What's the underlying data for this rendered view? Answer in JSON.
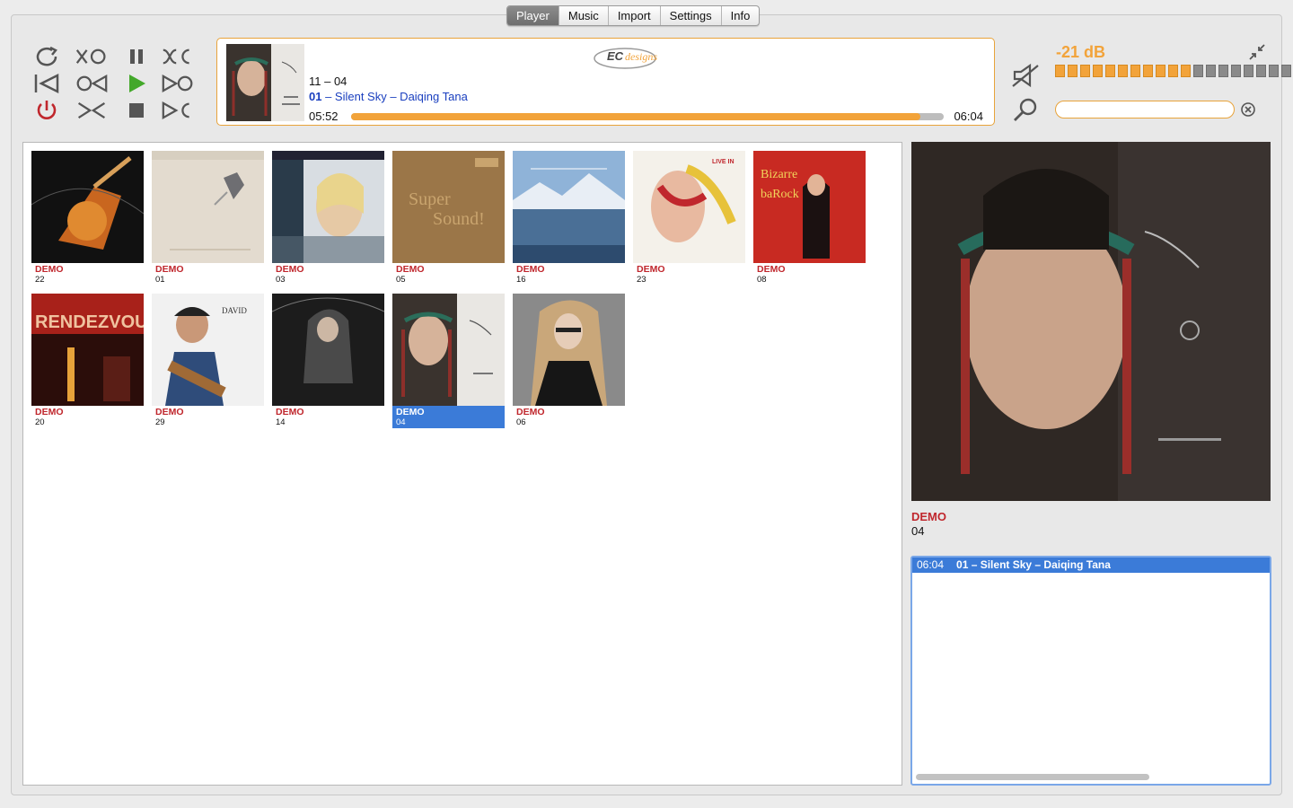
{
  "tabs": [
    {
      "label": "Player",
      "active": true
    },
    {
      "label": "Music",
      "active": false
    },
    {
      "label": "Import",
      "active": false
    },
    {
      "label": "Settings",
      "active": false
    },
    {
      "label": "Info",
      "active": false
    }
  ],
  "controls": {
    "icons": [
      "repeat-icon",
      "shuffle-off-icon",
      "pause-icon",
      "crossfade-icon",
      "previous-icon",
      "rewind-icon",
      "play-icon",
      "forward-icon",
      "power-icon",
      "shrink-icon",
      "stop-icon",
      "next-icon"
    ]
  },
  "nowplaying": {
    "album_track": "11 – 04",
    "track_no": "01",
    "track_rest": " – Silent Sky – Daiqing Tana",
    "elapsed": "05:52",
    "total": "06:04",
    "progress": 0.96,
    "logo_text": "EC designs"
  },
  "volume": {
    "readout": "-21 dB",
    "segments_total": 20,
    "segments_on": 11
  },
  "search": {
    "value": "",
    "placeholder": ""
  },
  "albums": [
    {
      "artist": "DEMO",
      "number": "22",
      "selected": false
    },
    {
      "artist": "DEMO",
      "number": "01",
      "selected": false
    },
    {
      "artist": "DEMO",
      "number": "03",
      "selected": false
    },
    {
      "artist": "DEMO",
      "number": "05",
      "selected": false
    },
    {
      "artist": "DEMO",
      "number": "16",
      "selected": false
    },
    {
      "artist": "DEMO",
      "number": "23",
      "selected": false
    },
    {
      "artist": "DEMO",
      "number": "08",
      "selected": false
    },
    {
      "artist": "DEMO",
      "number": "20",
      "selected": false
    },
    {
      "artist": "DEMO",
      "number": "29",
      "selected": false
    },
    {
      "artist": "DEMO",
      "number": "14",
      "selected": false
    },
    {
      "artist": "DEMO",
      "number": "04",
      "selected": true
    },
    {
      "artist": "DEMO",
      "number": "06",
      "selected": false
    }
  ],
  "selected_album": {
    "artist": "DEMO",
    "number": "04"
  },
  "tracklist": [
    {
      "duration": "06:04",
      "title": "01 – Silent Sky – Daiqing Tana"
    }
  ],
  "colors": {
    "accent": "#f2a33a",
    "selection": "#3b7bd8",
    "artist_red": "#c0272d"
  }
}
